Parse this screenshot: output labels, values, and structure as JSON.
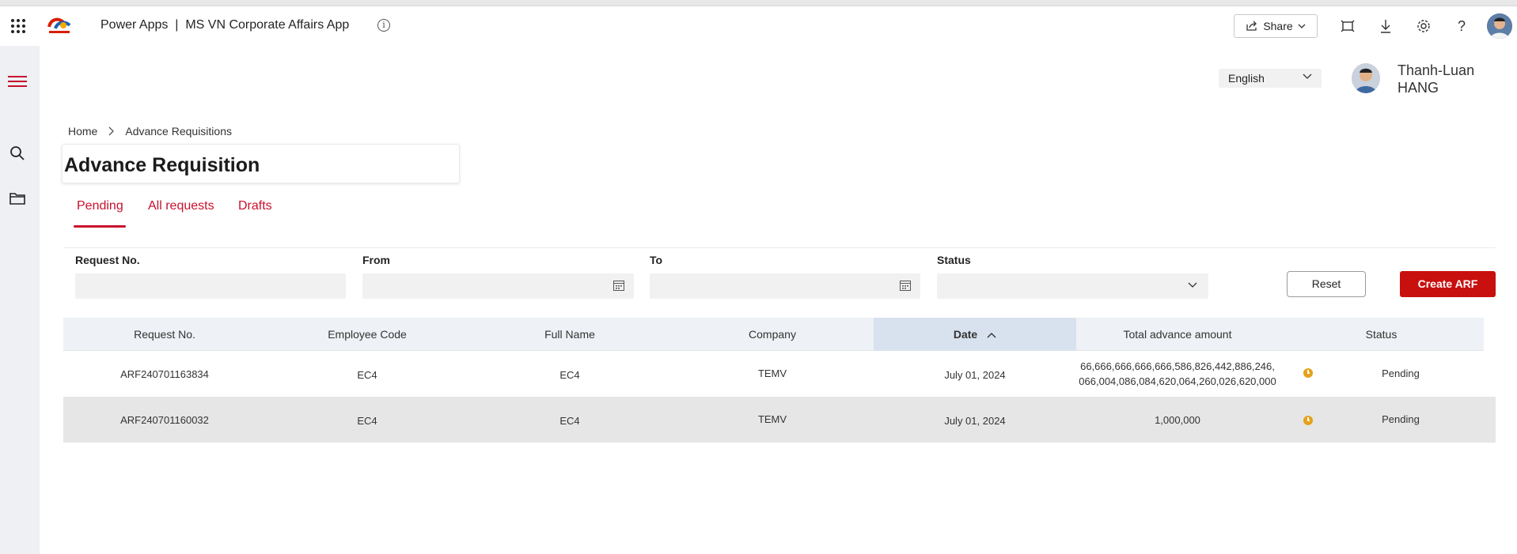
{
  "header": {
    "app_title": "Power Apps  |  MS VN Corporate Affairs App",
    "info_icon": "i",
    "share_label": "Share",
    "logo_text": "TotalEnergies"
  },
  "user": {
    "language": "English",
    "name": "Thanh-Luan HANG"
  },
  "breadcrumb": {
    "home": "Home",
    "current": "Advance Requisitions"
  },
  "page": {
    "title": "Advance Requisition"
  },
  "tabs": [
    {
      "label": "Pending"
    },
    {
      "label": "All requests"
    },
    {
      "label": "Drafts"
    }
  ],
  "filters": {
    "request_no_label": "Request No.",
    "from_label": "From",
    "to_label": "To",
    "status_label": "Status",
    "reset_label": "Reset",
    "create_label": "Create ARF"
  },
  "table": {
    "columns": [
      "Request No.",
      "Employee Code",
      "Full Name",
      "Company",
      "Date",
      "Total advance amount",
      "Status"
    ],
    "sorted_column": "Date",
    "sort_direction": "ascending",
    "rows": [
      {
        "request_no": "ARF240701163834",
        "employee_code": "EC4",
        "full_name": "EC4",
        "company": "TEMV",
        "date": "July 01, 2024",
        "amount_line1": "66,666,666,666,666,586,826,442,886,246,",
        "amount_line2": "066,004,086,084,620,064,260,026,620,000",
        "status": "Pending"
      },
      {
        "request_no": "ARF240701160032",
        "employee_code": "EC4",
        "full_name": "EC4",
        "company": "TEMV",
        "date": "July 01, 2024",
        "amount_line1": "1,000,000",
        "amount_line2": "",
        "status": "Pending"
      }
    ]
  },
  "colors": {
    "accent": "#c8102e",
    "primary_button": "#c8100e",
    "pending_clock": "#e4a11b",
    "rail_bg": "#eef0f4"
  }
}
